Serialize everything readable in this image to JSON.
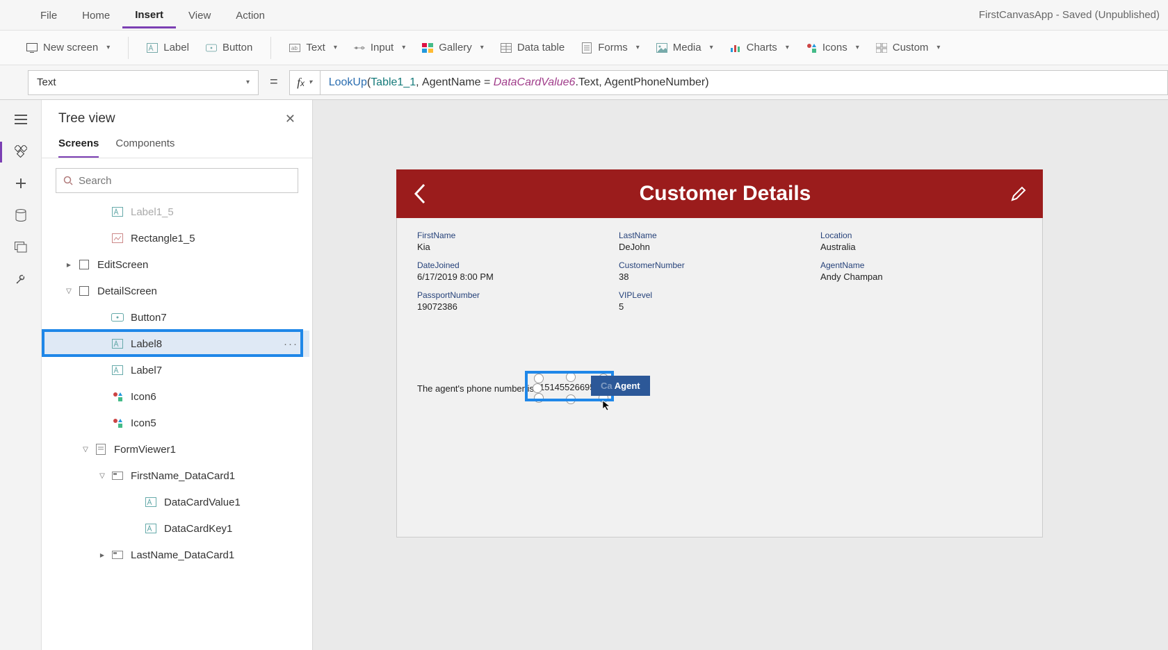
{
  "menu": {
    "items": [
      "File",
      "Home",
      "Insert",
      "View",
      "Action"
    ],
    "activeIndex": 2,
    "status": "FirstCanvasApp - Saved (Unpublished)"
  },
  "ribbon": {
    "newScreen": "New screen",
    "label": "Label",
    "button": "Button",
    "text": "Text",
    "input": "Input",
    "gallery": "Gallery",
    "dataTable": "Data table",
    "forms": "Forms",
    "media": "Media",
    "charts": "Charts",
    "icons": "Icons",
    "custom": "Custom"
  },
  "formulaBar": {
    "property": "Text",
    "formulaParts": {
      "fn": "LookUp",
      "table": "Table1_1",
      "expr1": "AgentName = ",
      "prop": "DataCardValue6",
      "expr2": ".Text, AgentPhoneNumber)"
    }
  },
  "treePanel": {
    "title": "Tree view",
    "tabs": [
      "Screens",
      "Components"
    ],
    "activeTab": 0,
    "searchPlaceholder": "Search",
    "items": [
      {
        "indent": 3,
        "icon": "label",
        "label": "Label1_5",
        "faded": true
      },
      {
        "indent": 3,
        "icon": "rect",
        "label": "Rectangle1_5"
      },
      {
        "indent": 1,
        "icon": "screen",
        "label": "EditScreen",
        "caret": ">"
      },
      {
        "indent": 1,
        "icon": "screen",
        "label": "DetailScreen",
        "caret": "v"
      },
      {
        "indent": 3,
        "icon": "btn",
        "label": "Button7"
      },
      {
        "indent": 3,
        "icon": "label",
        "label": "Label8",
        "selected": true,
        "dots": true
      },
      {
        "indent": 3,
        "icon": "label",
        "label": "Label7"
      },
      {
        "indent": 3,
        "icon": "icons",
        "label": "Icon6"
      },
      {
        "indent": 3,
        "icon": "icons",
        "label": "Icon5"
      },
      {
        "indent": 2,
        "icon": "form",
        "label": "FormViewer1",
        "caret": "v"
      },
      {
        "indent": 3,
        "icon": "card",
        "label": "FirstName_DataCard1",
        "caret": "v"
      },
      {
        "indent": 5,
        "icon": "label",
        "label": "DataCardValue1"
      },
      {
        "indent": 5,
        "icon": "label",
        "label": "DataCardKey1"
      },
      {
        "indent": 3,
        "icon": "card",
        "label": "LastName_DataCard1",
        "caret": ">"
      }
    ]
  },
  "preview": {
    "headerTitle": "Customer Details",
    "fields": {
      "col1": [
        {
          "label": "FirstName",
          "value": "Kia"
        },
        {
          "label": "DateJoined",
          "value": "6/17/2019 8:00 PM"
        },
        {
          "label": "PassportNumber",
          "value": "19072386"
        }
      ],
      "col2": [
        {
          "label": "LastName",
          "value": "DeJohn"
        },
        {
          "label": "CustomerNumber",
          "value": "38"
        },
        {
          "label": "VIPLevel",
          "value": "5"
        }
      ],
      "col3": [
        {
          "label": "Location",
          "value": "Australia"
        },
        {
          "label": "AgentName",
          "value": "Andy Champan"
        }
      ]
    },
    "agentLinePrefix": "The agent's phone number is ",
    "agentPhone": "15145526695",
    "agentButton": "Agent",
    "agentButtonCallPrefix": "Ca"
  }
}
